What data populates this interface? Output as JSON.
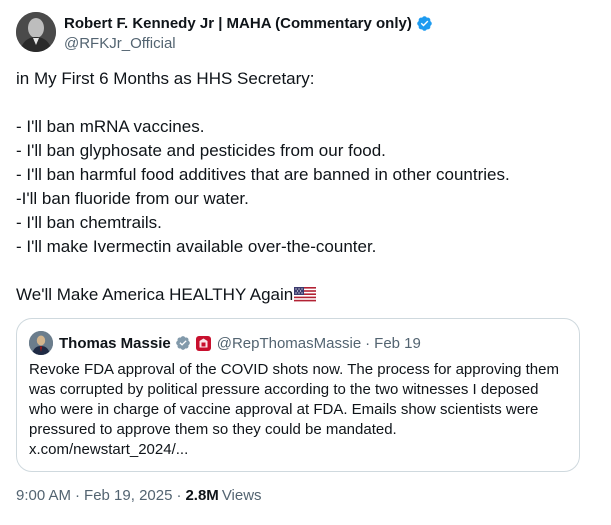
{
  "author": {
    "display_name": "Robert F. Kennedy Jr | MAHA (Commentary only)",
    "handle": "@RFKJr_Official"
  },
  "tweet": {
    "lines": [
      "in My First 6 Months as HHS Secretary:",
      "- I'll ban mRNA vaccines.",
      "- I'll ban glyphosate and pesticides from our food.",
      "- I'll ban harmful food additives that are banned in other countries.",
      "-I'll ban fluoride from our water.",
      "- I'll ban chemtrails.",
      "- I'll make Ivermectin available over-the-counter.",
      "We'll Make America HEALTHY Again"
    ],
    "flag_icon": "us-flag-emoji"
  },
  "quote": {
    "display_name": "Thomas Massie",
    "handle": "@RepThomasMassie",
    "separator": "·",
    "date": "Feb 19",
    "lines": [
      "Revoke FDA approval of the COVID shots now. The process for approving them",
      "was corrupted by political pressure according to the two witnesses I deposed",
      "who were in charge of vaccine approval at FDA. Emails show scientists were",
      "pressured to approve them so they could be mandated.",
      "x.com/newstart_2024/..."
    ]
  },
  "meta": {
    "time": "9:00 AM",
    "separator": "·",
    "date": "Feb 19, 2025",
    "views_count": "2.8M",
    "views_label": "Views"
  },
  "colors": {
    "text": "#0f1419",
    "secondary": "#536471",
    "verified_blue": "#1d9bf0",
    "verified_gray": "#829aab",
    "border": "#cfd9de",
    "badge_red": "#c8102e"
  }
}
